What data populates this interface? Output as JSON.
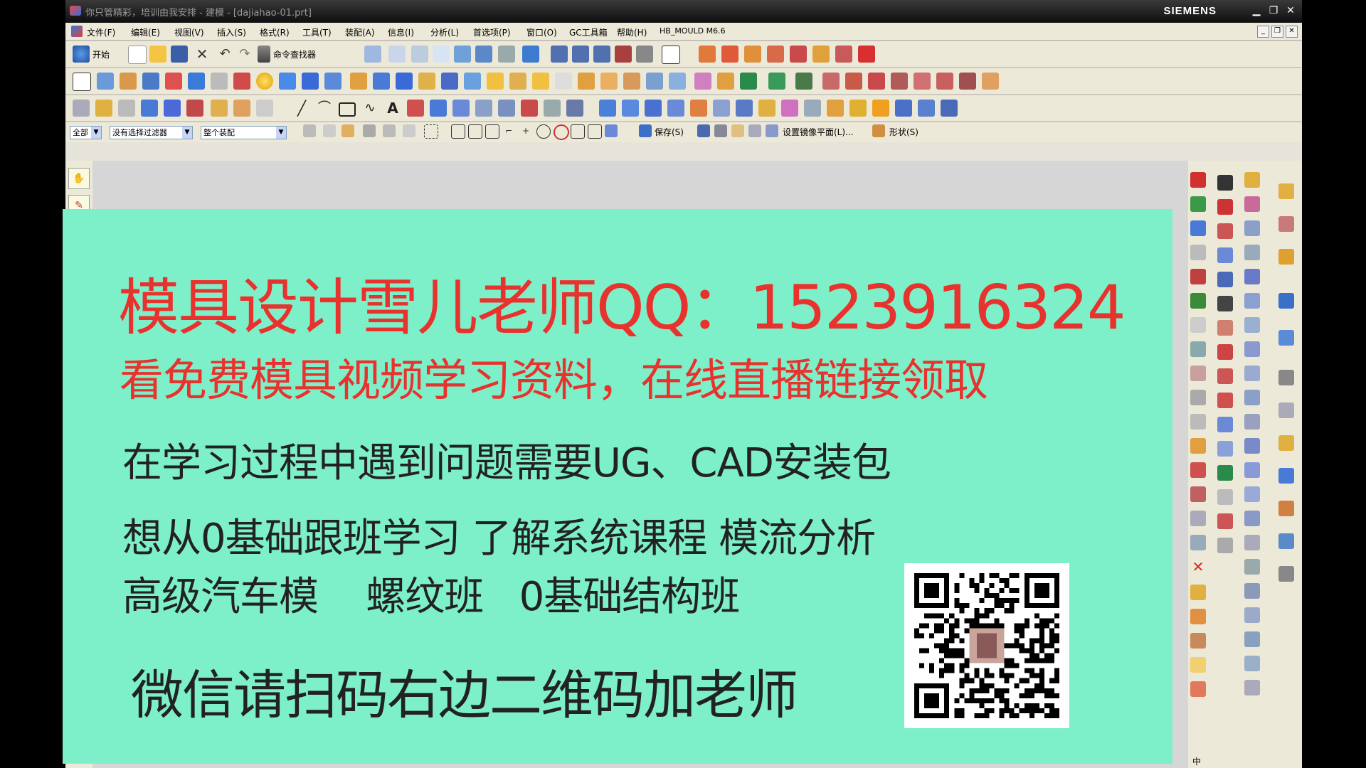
{
  "window": {
    "title": "你只管精彩，培训由我安排 - 建模 - [dajiahao-01.prt]",
    "brand": "SIEMENS",
    "controls": [
      "▁",
      "❐",
      "✕"
    ]
  },
  "menubar": {
    "items": [
      "文件(F)",
      "编辑(E)",
      "视图(V)",
      "插入(S)",
      "格式(R)",
      "工具(T)",
      "装配(A)",
      "信息(I)",
      "分析(L)",
      "首选项(P)",
      "窗口(O)",
      "GC工具箱",
      "帮助(H)",
      "HB_MOULD M6.6"
    ]
  },
  "toolbar": {
    "start_label": "开始",
    "command_finder_label": "命令查找器",
    "save_label": "保存(S)",
    "mirror_plane_label": "设置镜像平面(L)...",
    "shape_label": "形状(S)"
  },
  "filterbar": {
    "type_filter": "全部",
    "selection_filter": "没有选择过滤器",
    "scope": "整个装配"
  },
  "banner": {
    "line1": "模具设计雪儿老师QQ：1523916324",
    "line2": "看免费模具视频学习资料，在线直播链接领取",
    "line3": "在学习过程中遇到问题需要UG、CAD安装包",
    "line4": "想从0基础跟班学习 了解系统课程 模流分析",
    "line5": "高级汽车模    螺纹班   0基础结构班",
    "line6": "微信请扫码右边二维码加老师"
  },
  "colors": {
    "banner_bg": "#7ef0c9",
    "headline_red": "#e8322e",
    "body_text": "#222222"
  },
  "tray": {
    "ime": "中"
  }
}
